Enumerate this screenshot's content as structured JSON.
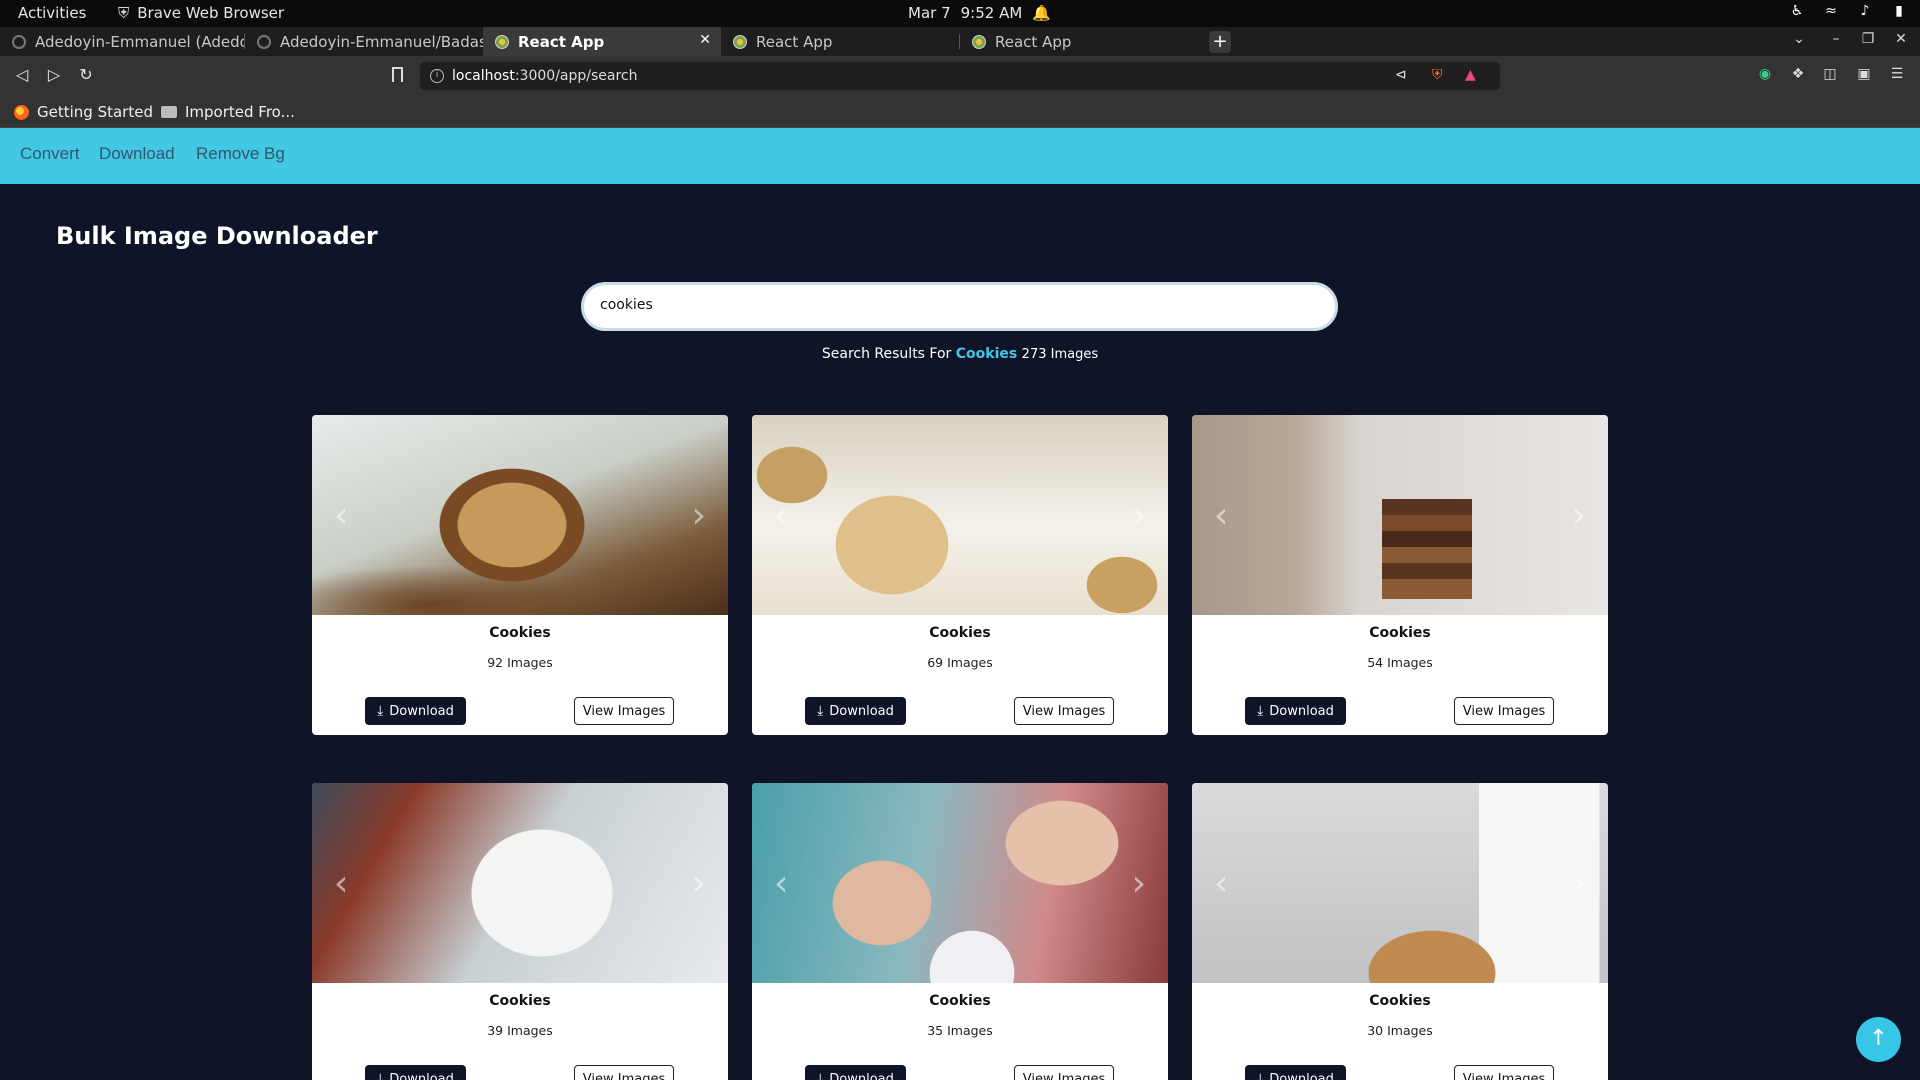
{
  "system": {
    "activities": "Activities",
    "app_name": "Brave Web Browser",
    "date": "Mar 7",
    "time": "9:52 AM"
  },
  "tabs": [
    {
      "title": "Adedoyin-Emmanuel (Adedoy",
      "active": false
    },
    {
      "title": "Adedoyin-Emmanuel/Badass",
      "active": false
    },
    {
      "title": "React App",
      "active": true
    },
    {
      "title": "React App",
      "active": false
    },
    {
      "title": "React App",
      "active": false
    }
  ],
  "toolbar": {
    "url_host": "localhost",
    "url_path": ":3000/app/search"
  },
  "bookmarks": [
    {
      "label": "Getting Started"
    },
    {
      "label": "Imported Fro..."
    }
  ],
  "app_nav": [
    "Convert",
    "Download",
    "Remove Bg"
  ],
  "page": {
    "title": "Bulk Image Downloader",
    "search_value": "cookies",
    "results_prefix": "Search Results For",
    "results_term": "Cookies",
    "results_count": "273 Images"
  },
  "cards": [
    {
      "title": "Cookies",
      "count": "92 Images",
      "download_label": "Download",
      "view_label": "View Images"
    },
    {
      "title": "Cookies",
      "count": "69 Images",
      "download_label": "Download",
      "view_label": "View Images"
    },
    {
      "title": "Cookies",
      "count": "54 Images",
      "download_label": "Download",
      "view_label": "View Images"
    },
    {
      "title": "Cookies",
      "count": "39 Images",
      "download_label": "Download",
      "view_label": "View Images"
    },
    {
      "title": "Cookies",
      "count": "35 Images",
      "download_label": "Download",
      "view_label": "View Images"
    },
    {
      "title": "Cookies",
      "count": "30 Images",
      "download_label": "Download",
      "view_label": "View Images"
    }
  ],
  "colors": {
    "nav_bg": "#42c7e5",
    "page_bg": "#0f1429",
    "accent": "#42c7e5"
  }
}
